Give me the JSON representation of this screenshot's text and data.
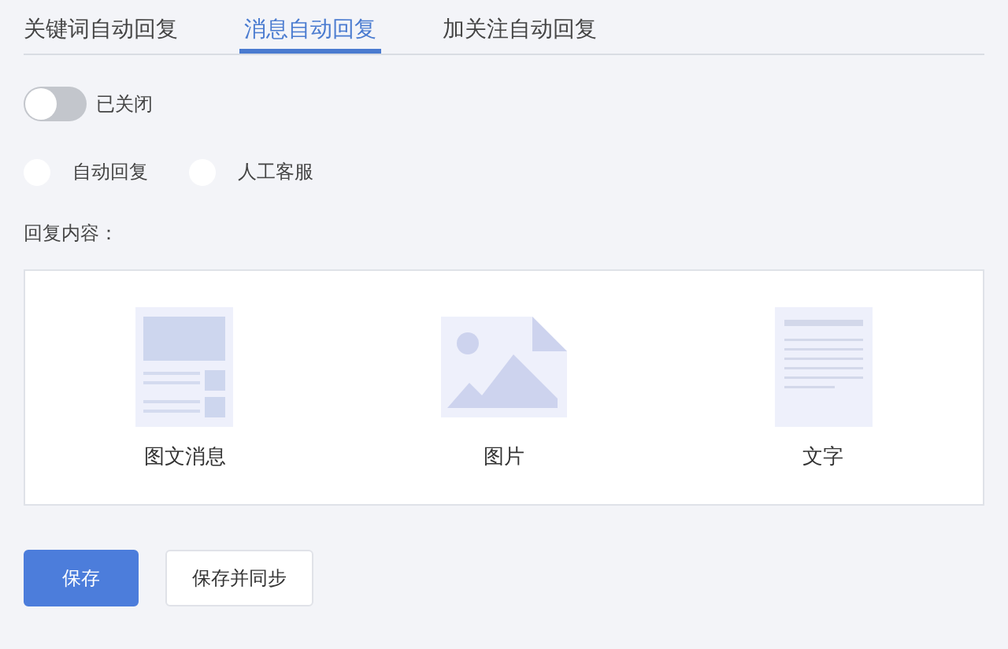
{
  "tabs": [
    {
      "label": "关键词自动回复",
      "selected": false
    },
    {
      "label": "消息自动回复",
      "selected": true
    },
    {
      "label": "加关注自动回复",
      "selected": false
    }
  ],
  "toggle": {
    "on": false,
    "label": "已关闭"
  },
  "reply_modes": [
    {
      "label": "自动回复",
      "selected": false
    },
    {
      "label": "人工客服",
      "selected": false
    }
  ],
  "content_label": "回复内容：",
  "content_types": [
    {
      "kind": "news",
      "label": "图文消息"
    },
    {
      "kind": "image",
      "label": "图片"
    },
    {
      "kind": "text",
      "label": "文字"
    }
  ],
  "buttons": [
    {
      "label": "保存",
      "kind": "primary"
    },
    {
      "label": "保存并同步",
      "kind": "secondary"
    }
  ]
}
